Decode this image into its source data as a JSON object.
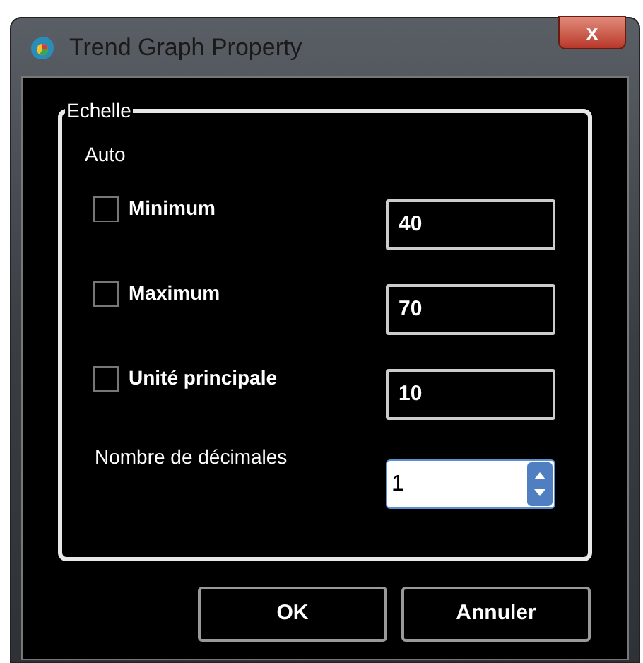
{
  "window": {
    "title": "Trend Graph Property",
    "close": "x"
  },
  "group": {
    "title": "Echelle",
    "subtitle": "Auto",
    "rows": [
      {
        "label": "Minimum",
        "checked": false,
        "value": "40"
      },
      {
        "label": "Maximum",
        "checked": false,
        "value": "70"
      },
      {
        "label": "Unité principale",
        "checked": false,
        "value": "10"
      }
    ],
    "decimals": {
      "label": "Nombre de décimales",
      "value": "1"
    }
  },
  "buttons": [
    "OK",
    "Annuler"
  ]
}
